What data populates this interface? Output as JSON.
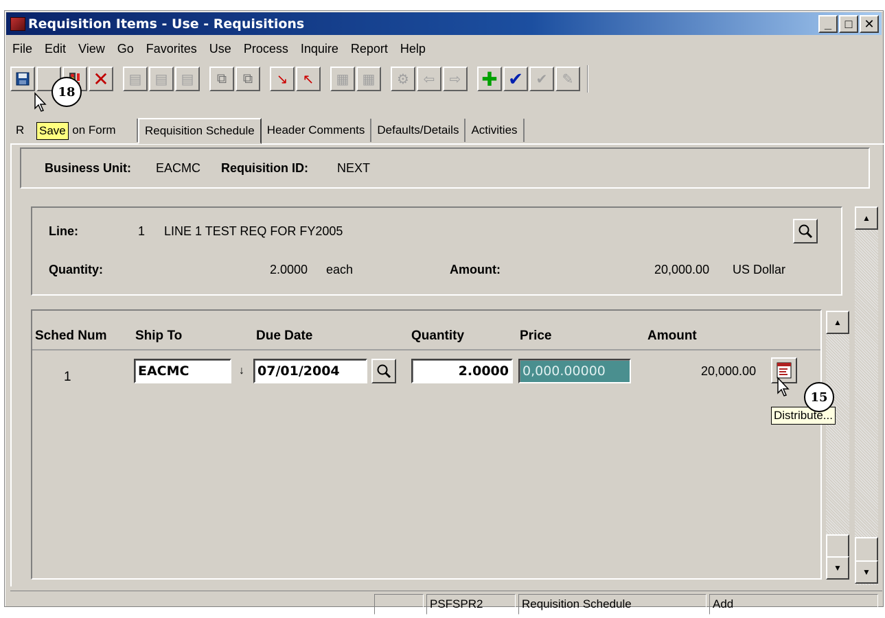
{
  "window": {
    "title": "Requisition Items - Use - Requisitions",
    "controls": {
      "minimize": "_",
      "maximize": "□",
      "close": "✕"
    }
  },
  "menu": [
    "File",
    "Edit",
    "View",
    "Go",
    "Favorites",
    "Use",
    "Process",
    "Inquire",
    "Report",
    "Help"
  ],
  "tooltips": {
    "save": "Save",
    "distribute": "Distribute..."
  },
  "callouts": {
    "save_step": "18",
    "distribute_step": "15"
  },
  "tabs": {
    "requisition_form": "Requisition Form",
    "requisition_form_visible": "R",
    "requisition_form_tail": "on Form",
    "requisition_schedule": "Requisition Schedule",
    "header_comments": "Header Comments",
    "defaults_details": "Defaults/Details",
    "activities": "Activities"
  },
  "header": {
    "business_unit_label": "Business Unit:",
    "business_unit": "EACMC",
    "requisition_id_label": "Requisition ID:",
    "requisition_id": "NEXT"
  },
  "line": {
    "line_label": "Line:",
    "line_num": "1",
    "description": "LINE 1 TEST REQ FOR FY2005",
    "quantity_label": "Quantity:",
    "quantity": "2.0000",
    "uom": "each",
    "amount_label": "Amount:",
    "amount": "20,000.00",
    "currency": "US Dollar"
  },
  "schedule": {
    "columns": [
      "Sched Num",
      "Ship To",
      "Due Date",
      "Quantity",
      "Price",
      "Amount"
    ],
    "rows": [
      {
        "sched_num": "1",
        "ship_to": "EACMC",
        "due_date": "07/01/2004",
        "quantity": "2.0000",
        "price": "0,000.00000",
        "amount": "20,000.00"
      }
    ]
  },
  "status": {
    "panel1": "",
    "server": "PSFSPR2",
    "page": "Requisition Schedule",
    "mode": "Add"
  }
}
